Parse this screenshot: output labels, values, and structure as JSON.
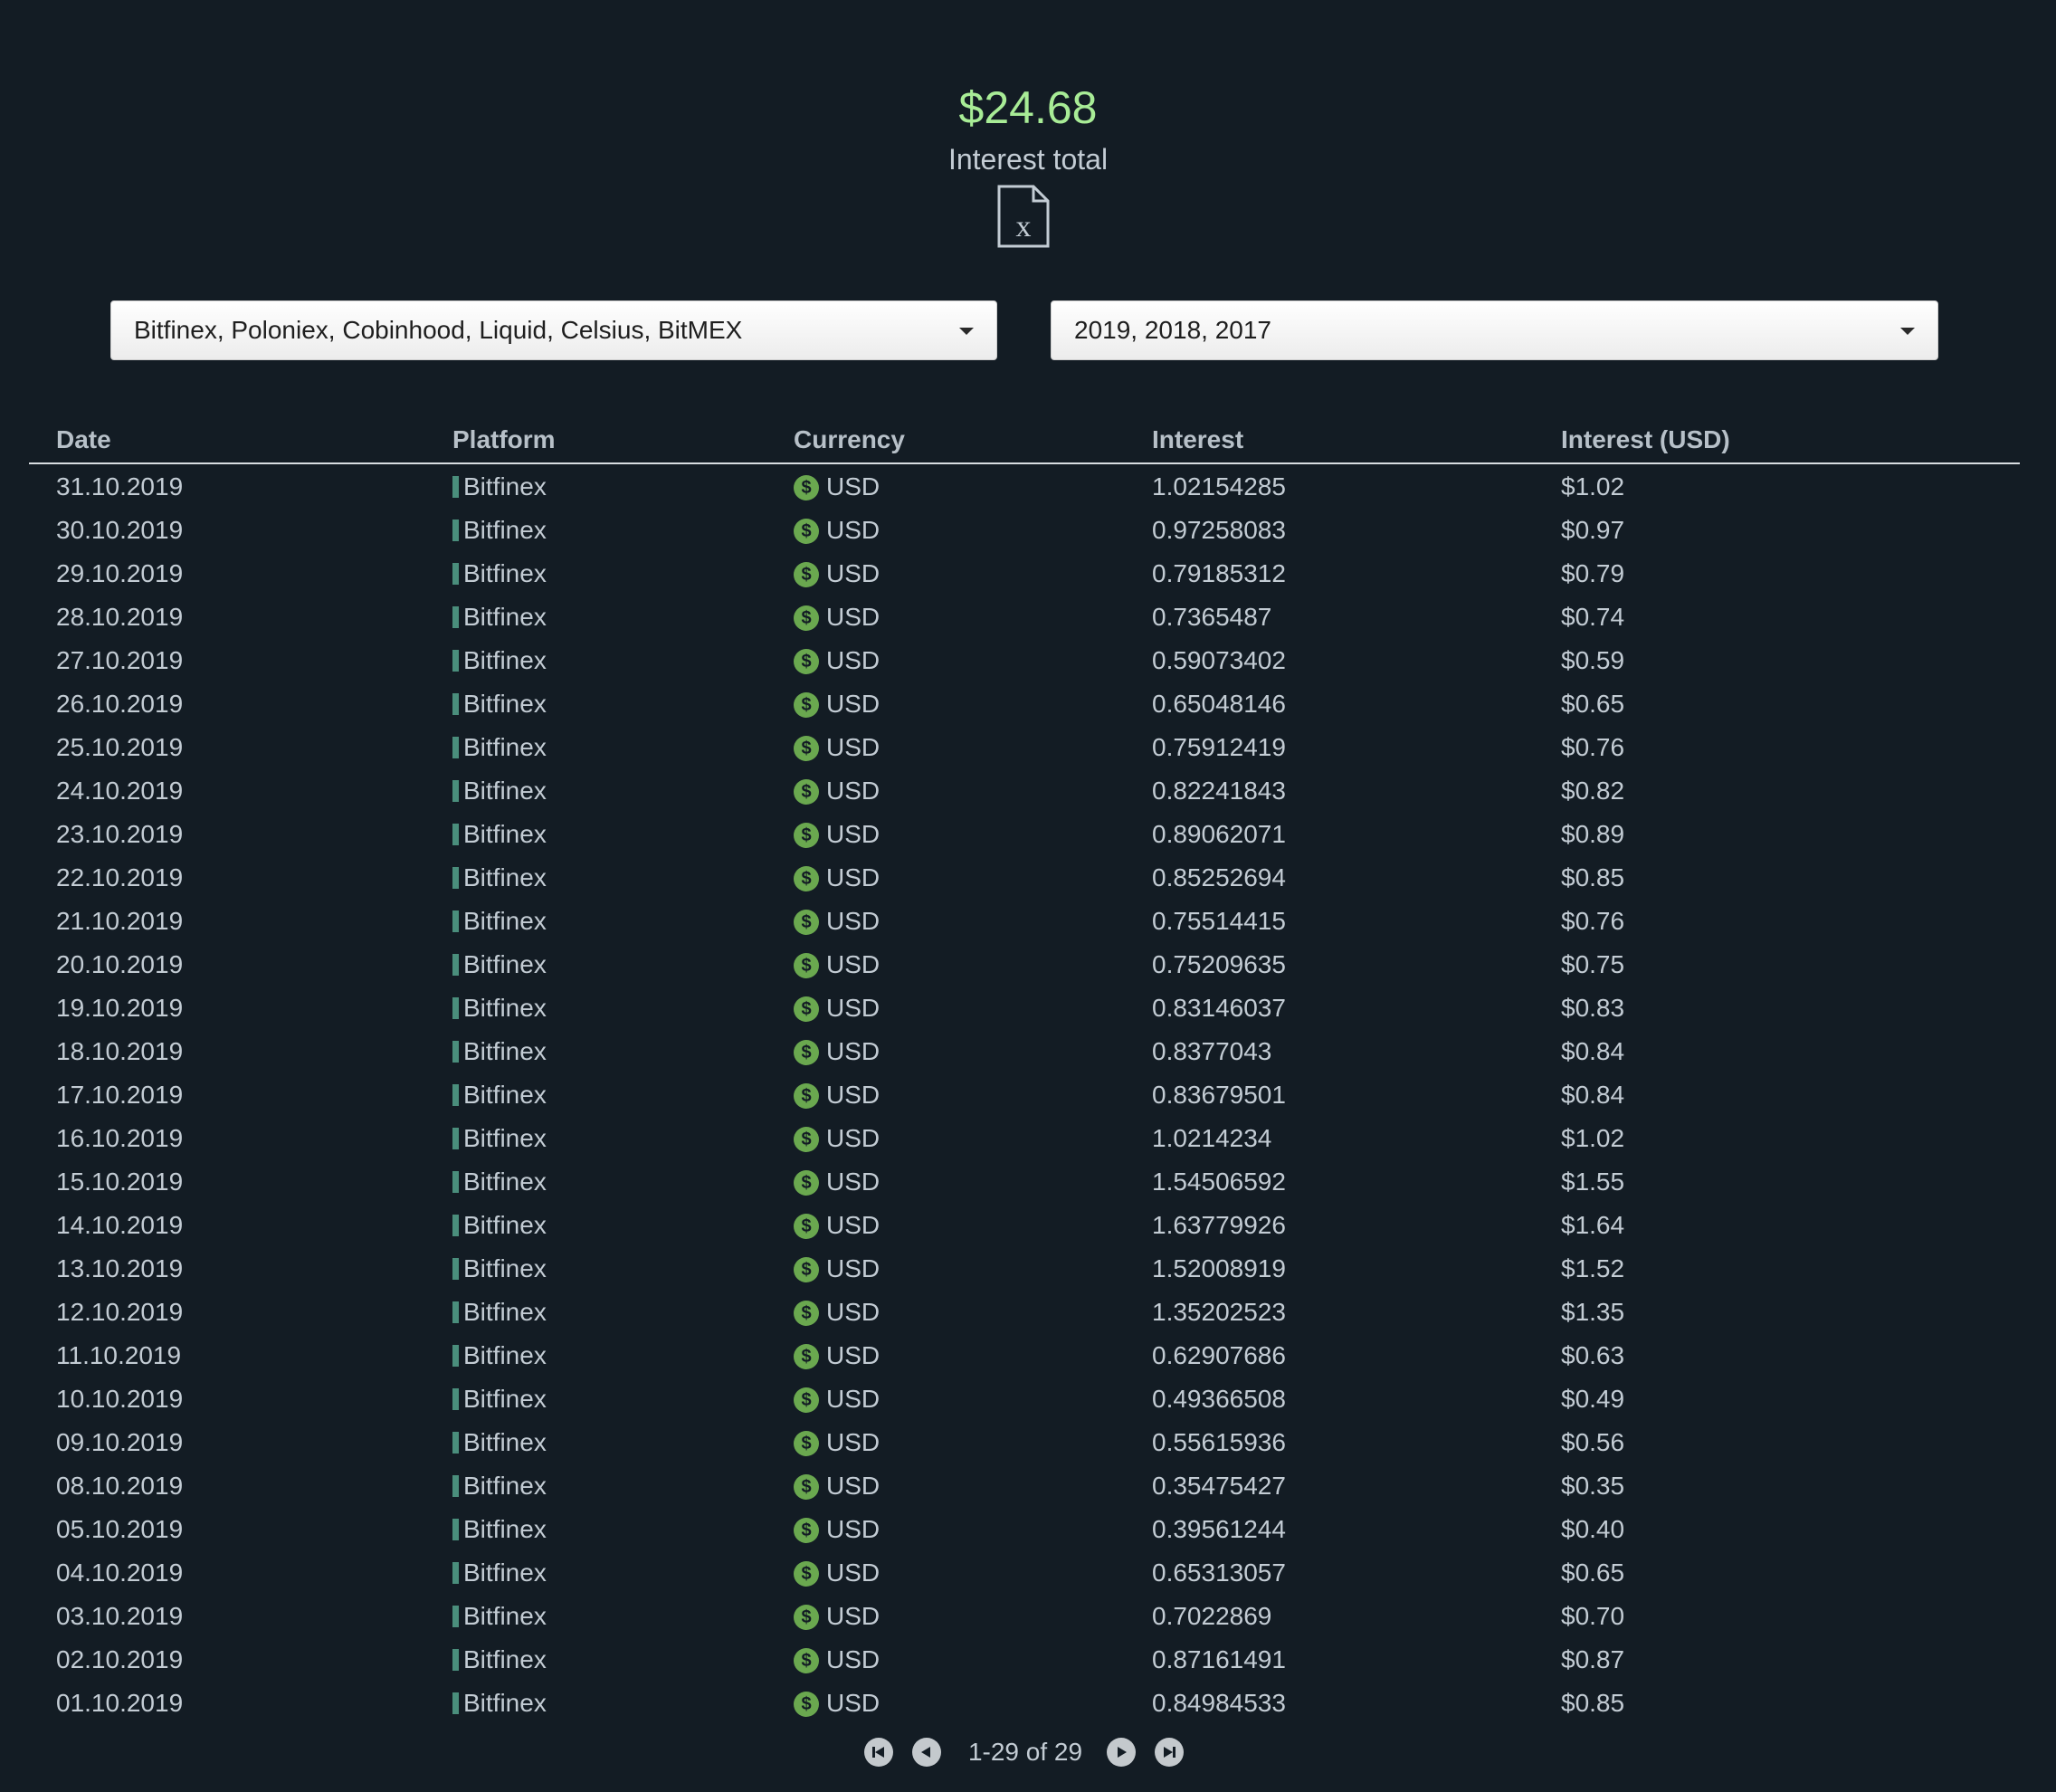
{
  "summary": {
    "total_amount": "$24.68",
    "total_label": "Interest total",
    "export_icon": "excel-export-icon"
  },
  "filters": {
    "platforms_value": "Bitfinex, Poloniex, Cobinhood, Liquid, Celsius, BitMEX",
    "years_value": "2019, 2018, 2017"
  },
  "table": {
    "headers": {
      "date": "Date",
      "platform": "Platform",
      "currency": "Currency",
      "interest": "Interest",
      "interest_usd": "Interest (USD)"
    },
    "rows": [
      {
        "date": "31.10.2019",
        "platform": "Bitfinex",
        "currency": "USD",
        "interest": "1.02154285",
        "interest_usd": "$1.02"
      },
      {
        "date": "30.10.2019",
        "platform": "Bitfinex",
        "currency": "USD",
        "interest": "0.97258083",
        "interest_usd": "$0.97"
      },
      {
        "date": "29.10.2019",
        "platform": "Bitfinex",
        "currency": "USD",
        "interest": "0.79185312",
        "interest_usd": "$0.79"
      },
      {
        "date": "28.10.2019",
        "platform": "Bitfinex",
        "currency": "USD",
        "interest": "0.7365487",
        "interest_usd": "$0.74"
      },
      {
        "date": "27.10.2019",
        "platform": "Bitfinex",
        "currency": "USD",
        "interest": "0.59073402",
        "interest_usd": "$0.59"
      },
      {
        "date": "26.10.2019",
        "platform": "Bitfinex",
        "currency": "USD",
        "interest": "0.65048146",
        "interest_usd": "$0.65"
      },
      {
        "date": "25.10.2019",
        "platform": "Bitfinex",
        "currency": "USD",
        "interest": "0.75912419",
        "interest_usd": "$0.76"
      },
      {
        "date": "24.10.2019",
        "platform": "Bitfinex",
        "currency": "USD",
        "interest": "0.82241843",
        "interest_usd": "$0.82"
      },
      {
        "date": "23.10.2019",
        "platform": "Bitfinex",
        "currency": "USD",
        "interest": "0.89062071",
        "interest_usd": "$0.89"
      },
      {
        "date": "22.10.2019",
        "platform": "Bitfinex",
        "currency": "USD",
        "interest": "0.85252694",
        "interest_usd": "$0.85"
      },
      {
        "date": "21.10.2019",
        "platform": "Bitfinex",
        "currency": "USD",
        "interest": "0.75514415",
        "interest_usd": "$0.76"
      },
      {
        "date": "20.10.2019",
        "platform": "Bitfinex",
        "currency": "USD",
        "interest": "0.75209635",
        "interest_usd": "$0.75"
      },
      {
        "date": "19.10.2019",
        "platform": "Bitfinex",
        "currency": "USD",
        "interest": "0.83146037",
        "interest_usd": "$0.83"
      },
      {
        "date": "18.10.2019",
        "platform": "Bitfinex",
        "currency": "USD",
        "interest": "0.8377043",
        "interest_usd": "$0.84"
      },
      {
        "date": "17.10.2019",
        "platform": "Bitfinex",
        "currency": "USD",
        "interest": "0.83679501",
        "interest_usd": "$0.84"
      },
      {
        "date": "16.10.2019",
        "platform": "Bitfinex",
        "currency": "USD",
        "interest": "1.0214234",
        "interest_usd": "$1.02"
      },
      {
        "date": "15.10.2019",
        "platform": "Bitfinex",
        "currency": "USD",
        "interest": "1.54506592",
        "interest_usd": "$1.55"
      },
      {
        "date": "14.10.2019",
        "platform": "Bitfinex",
        "currency": "USD",
        "interest": "1.63779926",
        "interest_usd": "$1.64"
      },
      {
        "date": "13.10.2019",
        "platform": "Bitfinex",
        "currency": "USD",
        "interest": "1.52008919",
        "interest_usd": "$1.52"
      },
      {
        "date": "12.10.2019",
        "platform": "Bitfinex",
        "currency": "USD",
        "interest": "1.35202523",
        "interest_usd": "$1.35"
      },
      {
        "date": "11.10.2019",
        "platform": "Bitfinex",
        "currency": "USD",
        "interest": "0.62907686",
        "interest_usd": "$0.63"
      },
      {
        "date": "10.10.2019",
        "platform": "Bitfinex",
        "currency": "USD",
        "interest": "0.49366508",
        "interest_usd": "$0.49"
      },
      {
        "date": "09.10.2019",
        "platform": "Bitfinex",
        "currency": "USD",
        "interest": "0.55615936",
        "interest_usd": "$0.56"
      },
      {
        "date": "08.10.2019",
        "platform": "Bitfinex",
        "currency": "USD",
        "interest": "0.35475427",
        "interest_usd": "$0.35"
      },
      {
        "date": "05.10.2019",
        "platform": "Bitfinex",
        "currency": "USD",
        "interest": "0.39561244",
        "interest_usd": "$0.40"
      },
      {
        "date": "04.10.2019",
        "platform": "Bitfinex",
        "currency": "USD",
        "interest": "0.65313057",
        "interest_usd": "$0.65"
      },
      {
        "date": "03.10.2019",
        "platform": "Bitfinex",
        "currency": "USD",
        "interest": "0.7022869",
        "interest_usd": "$0.70"
      },
      {
        "date": "02.10.2019",
        "platform": "Bitfinex",
        "currency": "USD",
        "interest": "0.87161491",
        "interest_usd": "$0.87"
      },
      {
        "date": "01.10.2019",
        "platform": "Bitfinex",
        "currency": "USD",
        "interest": "0.84984533",
        "interest_usd": "$0.85"
      }
    ],
    "currency_symbol": "$"
  },
  "pagination": {
    "range_text": "1-29 of 29",
    "first_icon": "first-page-icon",
    "prev_icon": "previous-page-icon",
    "next_icon": "next-page-icon",
    "last_icon": "last-page-icon"
  },
  "colors": {
    "background": "#131c24",
    "accent_green": "#a8ec96",
    "platform_bitfinex": "#4a8e7c",
    "currency_usd": "#6aa84f"
  }
}
